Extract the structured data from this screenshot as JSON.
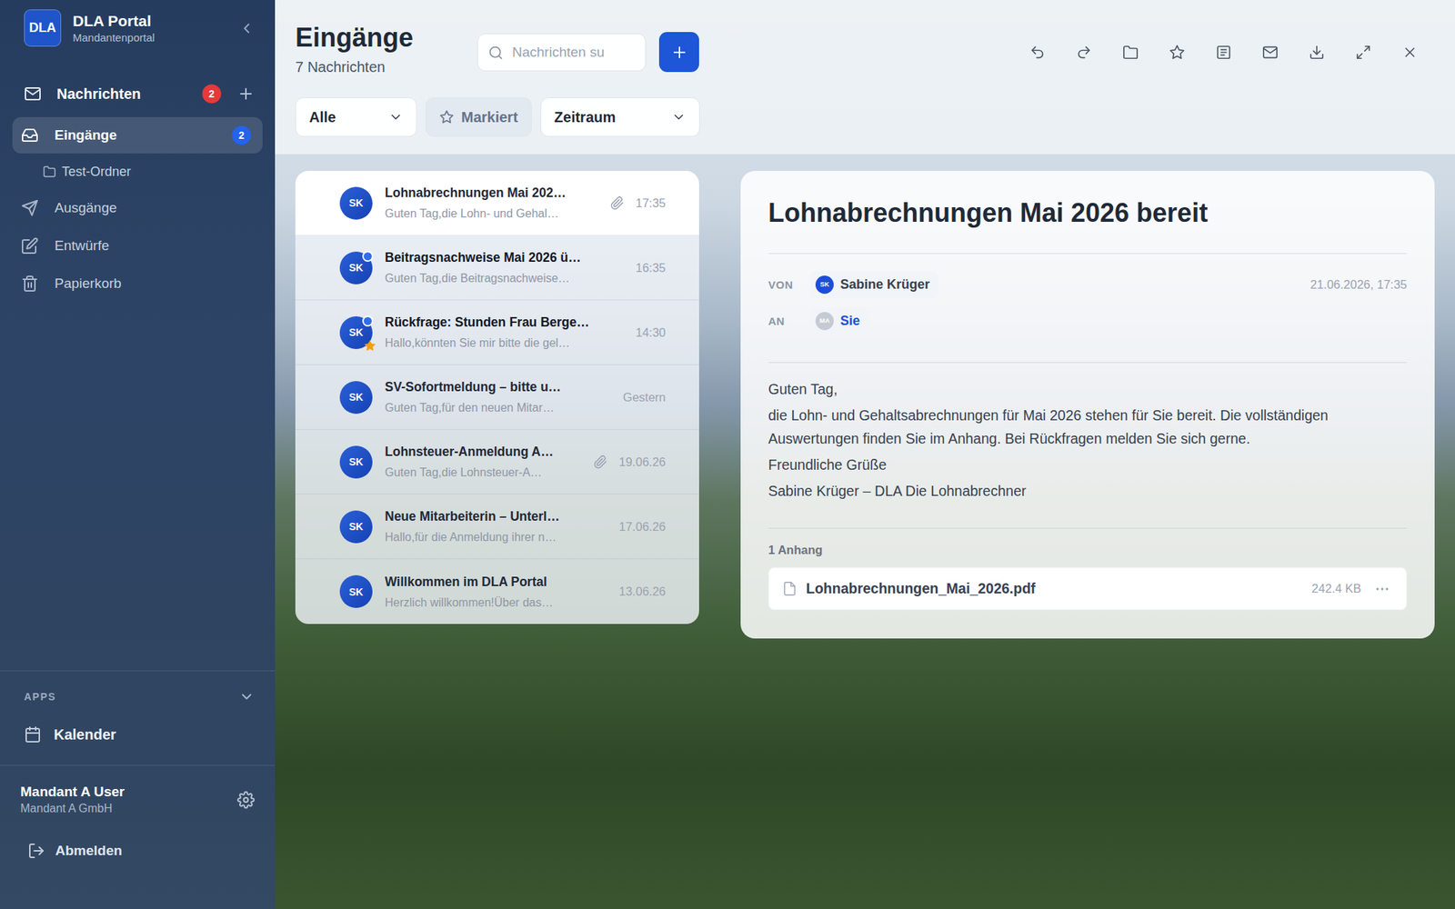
{
  "sidebar": {
    "logo": "DLA",
    "title": "DLA Portal",
    "subtitle": "Mandantenportal",
    "section": {
      "label": "Nachrichten",
      "badge": "2"
    },
    "folders": [
      {
        "label": "Eingänge",
        "kind": "folder",
        "selected": true,
        "badge": "2"
      },
      {
        "label": "Test-Ordner",
        "kind": "subfolder",
        "selected": false
      },
      {
        "label": "Ausgänge",
        "kind": "folder",
        "selected": false
      },
      {
        "label": "Entwürfe",
        "kind": "folder",
        "selected": false
      },
      {
        "label": "Papierkorb",
        "kind": "folder",
        "selected": false
      }
    ],
    "apps": {
      "label": "APPS",
      "expanded": true,
      "items": [
        {
          "label": "Kalender",
          "selected": false
        }
      ]
    },
    "user": {
      "name": "Mandant A User",
      "company": "Mandant A GmbH"
    },
    "logout": "Abmelden"
  },
  "header": {
    "title": "Eingänge",
    "count": "7 Nachrichten"
  },
  "search": {
    "placeholder": "Nachrichten su"
  },
  "filters": [
    {
      "label": "Alle",
      "kind": "dropdown",
      "selected": false
    },
    {
      "label": "Markiert",
      "kind": "toggle",
      "selected": false
    },
    {
      "label": "Zeitraum",
      "kind": "dropdown",
      "selected": false
    }
  ],
  "messages": [
    {
      "avatar": "SK",
      "subject": "Lohnabrechnungen Mai 202…",
      "preview": "Guten Tag,die Lohn- und Gehal…",
      "time": "17:35",
      "attachment": true,
      "unread": false,
      "starred": false,
      "selected": true
    },
    {
      "avatar": "SK",
      "subject": "Beitragsnachweise Mai 2026 ü…",
      "preview": "Guten Tag,die Beitragsnachweise…",
      "time": "16:35",
      "attachment": false,
      "unread": true,
      "starred": false,
      "selected": false
    },
    {
      "avatar": "SK",
      "subject": "Rückfrage: Stunden Frau Berge…",
      "preview": "Hallo,könnten Sie mir bitte die gel…",
      "time": "14:30",
      "attachment": false,
      "unread": true,
      "starred": true,
      "selected": false
    },
    {
      "avatar": "SK",
      "subject": "SV-Sofortmeldung – bitte u…",
      "preview": "Guten Tag,für den neuen Mitar…",
      "time": "Gestern",
      "attachment": false,
      "unread": false,
      "starred": false,
      "selected": false
    },
    {
      "avatar": "SK",
      "subject": "Lohnsteuer-Anmeldung A…",
      "preview": "Guten Tag,die Lohnsteuer-A…",
      "time": "19.06.26",
      "attachment": true,
      "unread": false,
      "starred": false,
      "selected": false
    },
    {
      "avatar": "SK",
      "subject": "Neue Mitarbeiterin – Unterl…",
      "preview": "Hallo,für die Anmeldung ihrer n…",
      "time": "17.06.26",
      "attachment": false,
      "unread": false,
      "starred": false,
      "selected": false
    },
    {
      "avatar": "SK",
      "subject": "Willkommen im DLA Portal",
      "preview": "Herzlich willkommen!Über das…",
      "time": "13.06.26",
      "attachment": false,
      "unread": false,
      "starred": false,
      "selected": false
    }
  ],
  "detail": {
    "title": "Lohnabrechnungen Mai 2026 bereit",
    "from_label": "VON",
    "from": {
      "avatar": "SK",
      "name": "Sabine Krüger"
    },
    "to_label": "AN",
    "to": {
      "avatar": "MA",
      "name": "Sie"
    },
    "date": "21.06.2026, 17:35",
    "body": [
      "Guten Tag,",
      "die Lohn- und Gehaltsabrechnungen für Mai 2026 stehen für Sie bereit. Die vollständigen Auswertungen finden Sie im Anhang. Bei Rückfragen melden Sie sich gerne.",
      "Freundliche Grüße",
      "Sabine Krüger – DLA Die Lohnabrechner"
    ],
    "attachments_label": "1 Anhang",
    "attachments": [
      {
        "name": "Lohnabrechnungen_Mai_2026.pdf",
        "size": "242.4 KB"
      }
    ]
  }
}
